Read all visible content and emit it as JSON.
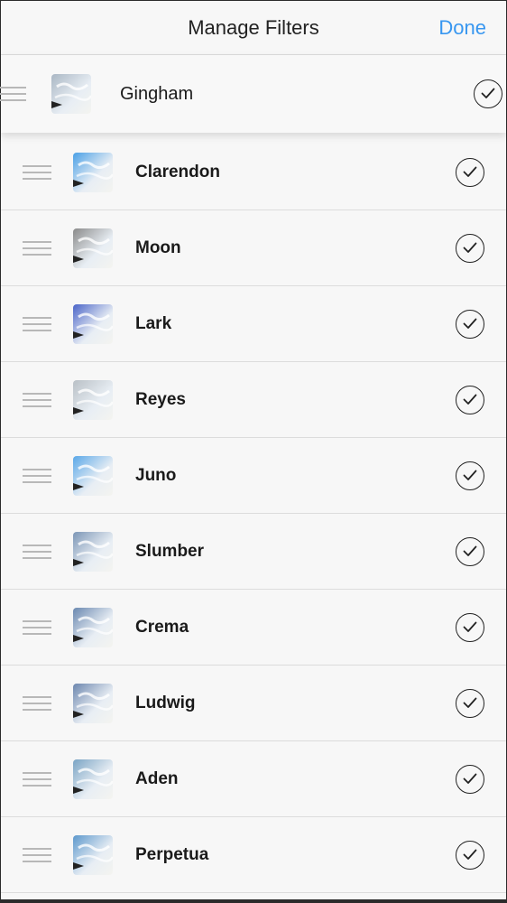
{
  "header": {
    "title": "Manage Filters",
    "done_label": "Done"
  },
  "colors": {
    "accent": "#3897f0",
    "divider": "#dcdcdc",
    "background": "#f7f7f7"
  },
  "filters": [
    {
      "name": "Gingham",
      "checked": true,
      "dragging": true,
      "tint": "#aab7c4"
    },
    {
      "name": "Clarendon",
      "checked": true,
      "tint": "#4aa0e6"
    },
    {
      "name": "Moon",
      "checked": true,
      "tint": "#8a8a8a"
    },
    {
      "name": "Lark",
      "checked": true,
      "tint": "#4a64c8"
    },
    {
      "name": "Reyes",
      "checked": true,
      "tint": "#b9c0c6"
    },
    {
      "name": "Juno",
      "checked": true,
      "tint": "#5aa8e8"
    },
    {
      "name": "Slumber",
      "checked": true,
      "tint": "#7c96b6"
    },
    {
      "name": "Crema",
      "checked": true,
      "tint": "#6a88b0"
    },
    {
      "name": "Ludwig",
      "checked": true,
      "tint": "#6c86ae"
    },
    {
      "name": "Aden",
      "checked": true,
      "tint": "#7aa4c4"
    },
    {
      "name": "Perpetua",
      "checked": true,
      "tint": "#5c98cc"
    }
  ],
  "icons": {
    "drag_handle": "drag-handle-icon",
    "checkmark": "checkmark-icon"
  }
}
